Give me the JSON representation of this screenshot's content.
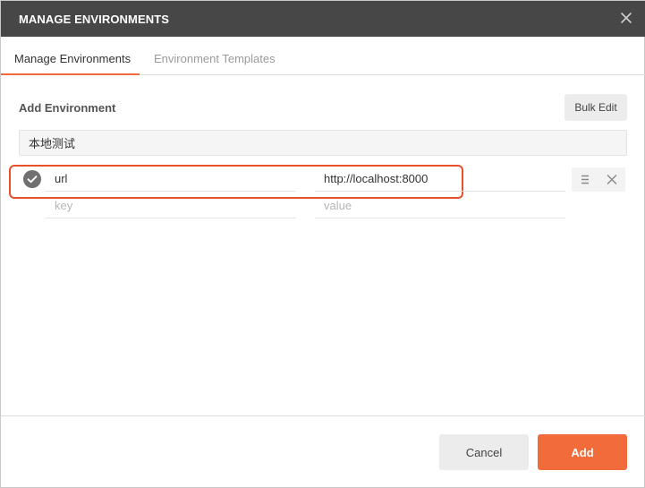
{
  "dialog": {
    "title": "MANAGE ENVIRONMENTS"
  },
  "tabs": [
    {
      "label": "Manage Environments",
      "active": true
    },
    {
      "label": "Environment Templates",
      "active": false
    }
  ],
  "section": {
    "title": "Add Environment",
    "bulk_edit_label": "Bulk Edit"
  },
  "environment": {
    "name": "本地测试"
  },
  "variables": [
    {
      "enabled": true,
      "key": "url",
      "value": "http://localhost:8000"
    }
  ],
  "new_variable": {
    "key_placeholder": "key",
    "value_placeholder": "value"
  },
  "footer": {
    "cancel_label": "Cancel",
    "add_label": "Add"
  },
  "colors": {
    "accent": "#f26b3a",
    "titlebar": "#474747",
    "highlight": "#e8502a"
  },
  "icons": {
    "close": "close-icon",
    "check": "check-circle-icon",
    "menu": "menu-lines-icon",
    "delete": "delete-x-icon"
  }
}
